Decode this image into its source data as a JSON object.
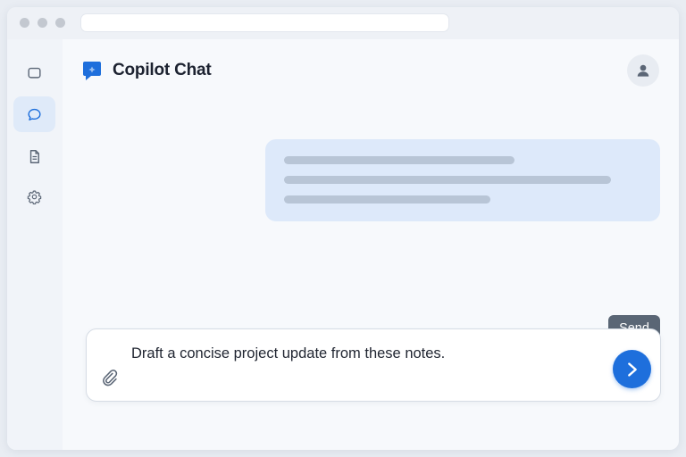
{
  "header": {
    "title": "Copilot Chat"
  },
  "sidebar": {
    "items": [
      {
        "icon": "chat-square-icon"
      },
      {
        "icon": "chat-bubble-icon",
        "active": true
      },
      {
        "icon": "document-icon"
      },
      {
        "icon": "gear-icon"
      }
    ]
  },
  "composer": {
    "text": "Draft a concise project update from these notes.",
    "send_tooltip": "Send"
  },
  "colors": {
    "accent": "#1e6fdc",
    "bubble": "#dde9fa",
    "active_nav": "#dfeaf9"
  }
}
